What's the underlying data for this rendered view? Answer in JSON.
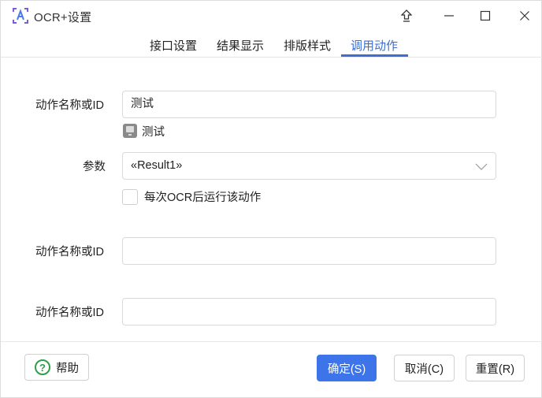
{
  "window": {
    "title": "OCR+设置",
    "icon": "app-ocr-icon"
  },
  "title_buttons": {
    "pin": "pin-icon",
    "minimize": "minimize-icon",
    "maximize": "maximize-icon",
    "close": "close-icon"
  },
  "tabs": [
    {
      "label": "接口设置",
      "active": false
    },
    {
      "label": "结果显示",
      "active": false
    },
    {
      "label": "排版样式",
      "active": false
    },
    {
      "label": "调用动作",
      "active": true
    }
  ],
  "accent_color": "#3a6fd6",
  "form": {
    "action1": {
      "label": "动作名称或ID",
      "value": "测试",
      "tag_text": "测试"
    },
    "params": {
      "label": "参数",
      "value": "«Result1»"
    },
    "run_after_ocr": {
      "label": "每次OCR后运行该动作",
      "checked": false
    },
    "action2": {
      "label": "动作名称或ID",
      "value": ""
    },
    "action3": {
      "label": "动作名称或ID",
      "value": ""
    }
  },
  "footer": {
    "help_label": "帮助",
    "ok_label": "确定(S)",
    "cancel_label": "取消(C)",
    "reset_label": "重置(R)"
  }
}
